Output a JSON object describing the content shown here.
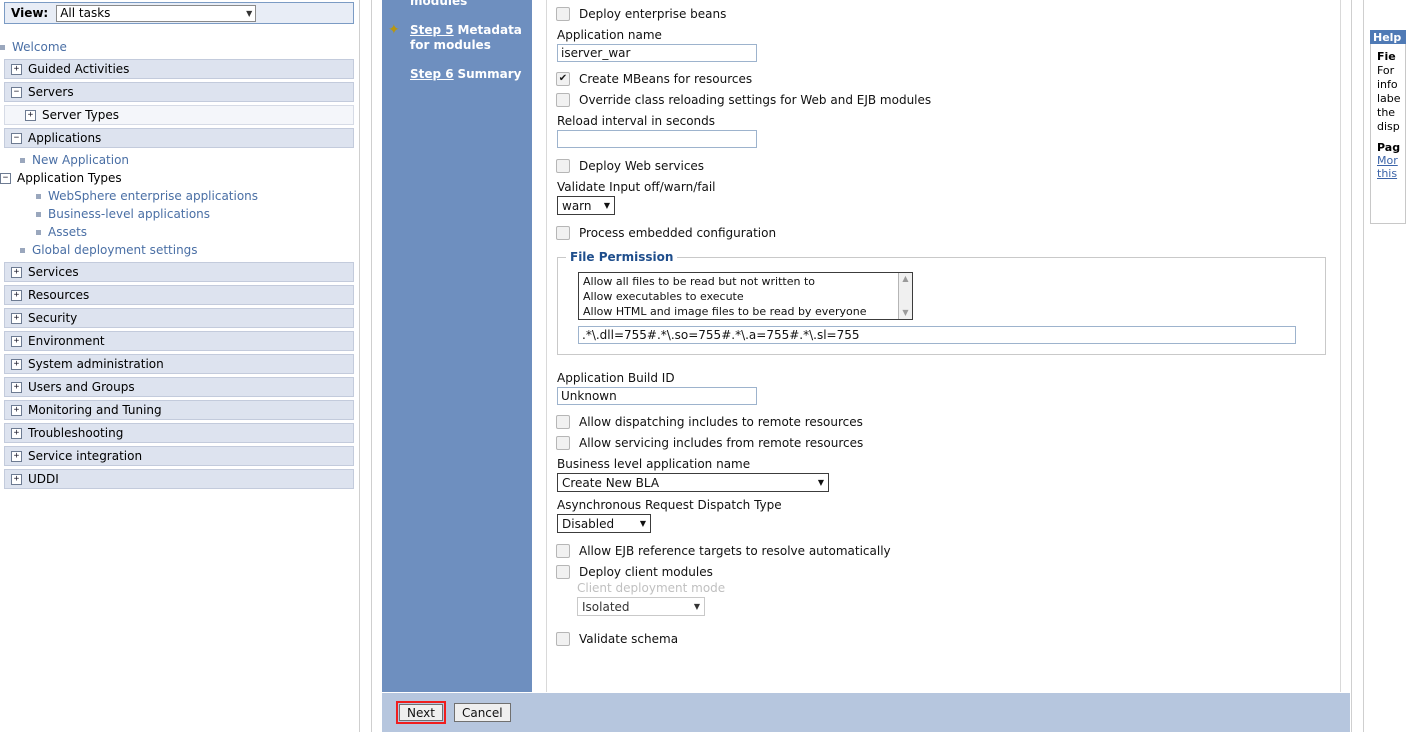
{
  "nav": {
    "view_label": "View:",
    "view_value": "All tasks",
    "caret": "▼",
    "items": [
      {
        "type": "leaf",
        "label": "Welcome",
        "indent": 0,
        "icon": "bullet-icon"
      },
      {
        "type": "group",
        "label": "Guided Activities",
        "indent": 0,
        "toggle": "+"
      },
      {
        "type": "group",
        "label": "Servers",
        "indent": 0,
        "toggle": "−"
      },
      {
        "type": "sub",
        "label": "Server Types",
        "indent": 1,
        "toggle": "+"
      },
      {
        "type": "group",
        "label": "Applications",
        "indent": 0,
        "toggle": "−"
      },
      {
        "type": "leaf",
        "label": "New Application",
        "indent": 1,
        "icon": "bullet-icon"
      },
      {
        "type": "plain",
        "label": "Application Types",
        "indent": 1,
        "toggle": "−"
      },
      {
        "type": "leaf",
        "label": "WebSphere enterprise applications",
        "indent": 2,
        "icon": "bullet-icon"
      },
      {
        "type": "leaf",
        "label": "Business-level applications",
        "indent": 2,
        "icon": "bullet-icon"
      },
      {
        "type": "leaf",
        "label": "Assets",
        "indent": 2,
        "icon": "bullet-icon"
      },
      {
        "type": "leaf",
        "label": "Global deployment settings",
        "indent": 1,
        "icon": "bullet-icon"
      },
      {
        "type": "group",
        "label": "Services",
        "indent": 0,
        "toggle": "+"
      },
      {
        "type": "group",
        "label": "Resources",
        "indent": 0,
        "toggle": "+"
      },
      {
        "type": "group",
        "label": "Security",
        "indent": 0,
        "toggle": "+"
      },
      {
        "type": "group",
        "label": "Environment",
        "indent": 0,
        "toggle": "+"
      },
      {
        "type": "group",
        "label": "System administration",
        "indent": 0,
        "toggle": "+"
      },
      {
        "type": "group",
        "label": "Users and Groups",
        "indent": 0,
        "toggle": "+"
      },
      {
        "type": "group",
        "label": "Monitoring and Tuning",
        "indent": 0,
        "toggle": "+"
      },
      {
        "type": "group",
        "label": "Troubleshooting",
        "indent": 0,
        "toggle": "+"
      },
      {
        "type": "group",
        "label": "Service integration",
        "indent": 0,
        "toggle": "+"
      },
      {
        "type": "group",
        "label": "UDDI",
        "indent": 0,
        "toggle": "+"
      }
    ]
  },
  "steps": {
    "items": [
      {
        "num": "",
        "label": "modules",
        "current": false,
        "cut": true
      },
      {
        "num": "Step 5",
        "label": "Metadata for modules",
        "current": true,
        "cut": false
      },
      {
        "num": "Step 6",
        "label": "Summary",
        "current": false,
        "cut": false
      }
    ],
    "current_marker": "✦"
  },
  "form": {
    "deploy_enterprise_beans": {
      "label": "Deploy enterprise beans",
      "checked": false
    },
    "application_name": {
      "label": "Application name",
      "value": "iserver_war",
      "placeholder": ""
    },
    "create_mbeans": {
      "label": "Create MBeans for resources",
      "checked": true
    },
    "override_class_reloading": {
      "label": "Override class reloading settings for Web and EJB modules",
      "checked": false
    },
    "reload_interval": {
      "label": "Reload interval in seconds",
      "value": "",
      "placeholder": ""
    },
    "deploy_web_services": {
      "label": "Deploy Web services",
      "checked": false
    },
    "validate_input": {
      "label": "Validate Input off/warn/fail",
      "value": "warn",
      "caret": "▼"
    },
    "process_embedded_config": {
      "label": "Process embedded configuration",
      "checked": false
    },
    "file_permission": {
      "legend": "File Permission",
      "options": [
        "Allow all files to be read but not written to",
        "Allow executables to execute",
        "Allow HTML and image files to be read by everyone"
      ],
      "scroll_up": "▲",
      "scroll_down": "▼",
      "value": ".*\\.dll=755#.*\\.so=755#.*\\.a=755#.*\\.sl=755"
    },
    "application_build_id": {
      "label": "Application Build ID",
      "value": "Unknown"
    },
    "allow_dispatching_includes": {
      "label": "Allow dispatching includes to remote resources",
      "checked": false
    },
    "allow_servicing_includes": {
      "label": "Allow servicing includes from remote resources",
      "checked": false
    },
    "business_level_app_name": {
      "label": "Business level application name",
      "value": "Create New BLA",
      "caret": "▼"
    },
    "async_request_dispatch_type": {
      "label": "Asynchronous Request Dispatch Type",
      "value": "Disabled",
      "caret": "▼"
    },
    "allow_ejb_reference": {
      "label": "Allow EJB reference targets to resolve automatically",
      "checked": false
    },
    "deploy_client_modules": {
      "label": "Deploy client modules",
      "checked": false
    },
    "client_deployment_mode": {
      "label": "Client deployment mode",
      "value": "Isolated",
      "caret": "▼",
      "disabled": true
    },
    "validate_schema": {
      "label": "Validate schema",
      "checked": false
    }
  },
  "buttons": {
    "next": "Next",
    "cancel": "Cancel"
  },
  "help": {
    "title": "Help",
    "section_field": "Fie",
    "lines": [
      "For",
      "info",
      "labe",
      "the",
      "disp"
    ],
    "section_page": "Pag",
    "links": [
      "Mor",
      "this"
    ]
  },
  "colors": {
    "step_panel_blue": "#6e8fbf",
    "button_bar_blue": "#b6c6de",
    "help_header_blue": "#4f7ab5",
    "link_blue": "#4a6fa5",
    "highlight_red": "#f01e1e",
    "legend_blue": "#1f4e8c"
  }
}
